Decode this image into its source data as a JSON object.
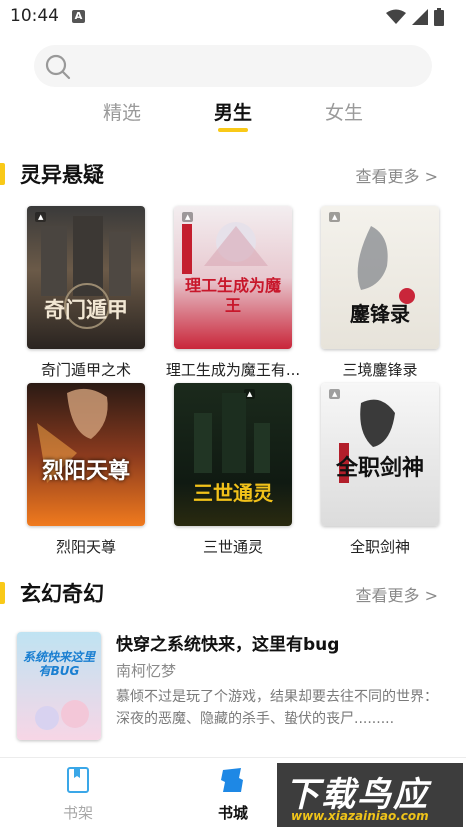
{
  "status": {
    "time": "10:44",
    "app_badge": "A"
  },
  "tabs": [
    {
      "label": "精选"
    },
    {
      "label": "男生"
    },
    {
      "label": "女生"
    }
  ],
  "sections": [
    {
      "title": "灵异悬疑",
      "more": "查看更多 >",
      "books": [
        {
          "title": "奇门遁甲之术",
          "cover_text": "奇门遁甲"
        },
        {
          "title": "理工生成为魔王有...",
          "cover_text": "理工生成为魔王"
        },
        {
          "title": "三境鏖锋录",
          "cover_text": "鏖锋录"
        },
        {
          "title": "烈阳天尊",
          "cover_text": "烈阳天尊"
        },
        {
          "title": "三世通灵",
          "cover_text": "三世通灵"
        },
        {
          "title": "全职剑神",
          "cover_text": "全职剑神"
        }
      ]
    },
    {
      "title": "玄幻奇幻",
      "more": "查看更多 >",
      "list": [
        {
          "title": "快穿之系统快来，这里有bug",
          "author": "南柯忆梦",
          "desc": "慕倾不过是玩了个游戏，结果却要去往不同的世界：深夜的恶魔、隐藏的杀手、蛰伏的丧尸.........",
          "cover_text": "系统快来这里有BUG"
        }
      ]
    }
  ],
  "bottom_nav": [
    {
      "label": "书架",
      "icon": "book-icon"
    },
    {
      "label": "书城",
      "icon": "store-icon"
    }
  ],
  "watermark": {
    "main": "下载鸟应用",
    "sub": "www.xiazainiao.com"
  },
  "colors": {
    "accent": "#f9c918"
  }
}
